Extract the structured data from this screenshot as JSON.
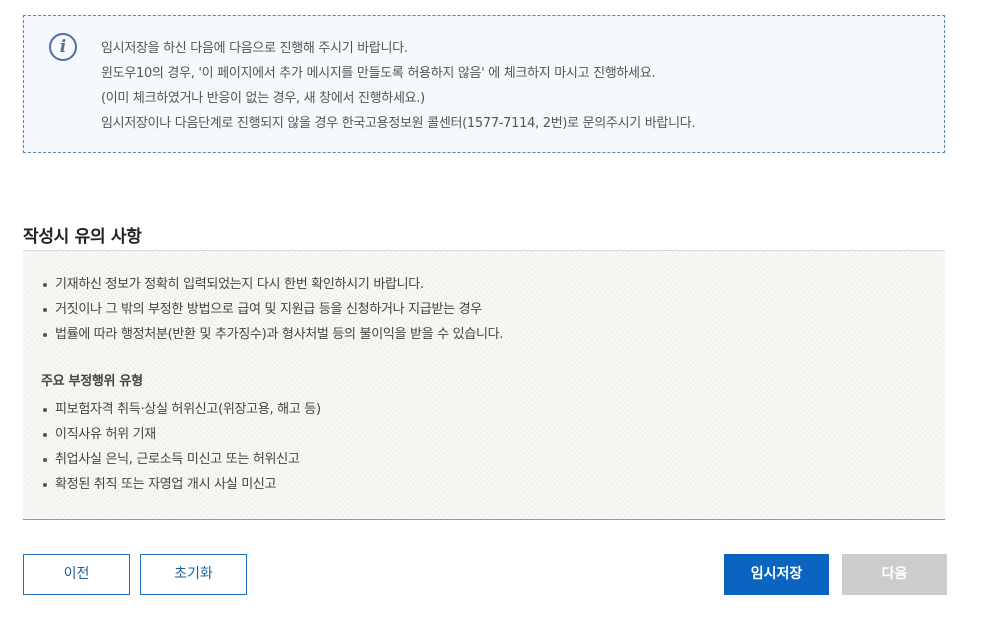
{
  "notice": {
    "icon": "info-icon",
    "lines": [
      "임시저장을 하신 다음에 다음으로 진행해 주시기 바랍니다.",
      "윈도우10의 경우, '이 페이지에서 추가 메시지를 만들도록 허용하지 않음' 에 체크하지 마시고 진행하세요.",
      "(이미 체크하였거나 반응이 없는 경우, 새 창에서 진행하세요.)",
      "임시저장이나 다음단계로 진행되지 않을 경우 한국고용정보원 콜센터(1577-7114, 2번)로 문의주시기 바랍니다."
    ]
  },
  "caution": {
    "title": "작성시 유의 사항",
    "items": [
      "기재하신 정보가 정확히 입력되었는지 다시 한번 확인하시기 바랍니다.",
      "거짓이나 그 밖의 부정한 방법으로 급여 및 지원급 등을 신청하거나 지급받는 경우",
      "법률에 따라 행정처분(반환 및 추가징수)과 형사처벌 등의 불이익을 받을 수 있습니다."
    ],
    "subheading": "주요 부정행위 유형",
    "fraud_types": [
      "피보험자격 취득·상실 허위신고(위장고용, 해고 등)",
      "이직사유 허위 기재",
      "취업사실 은닉, 근로소득 미신고 또는 허위신고",
      "확정된 취직 또는 자영업 개시 사실 미신고"
    ]
  },
  "buttons": {
    "prev": "이전",
    "reset": "초기화",
    "save": "임시저장",
    "next": "다음"
  },
  "colors": {
    "primary": "#0a64c0",
    "disabled": "#cccccc",
    "notice_border": "#5a86a8",
    "notice_bg": "#f5f9fd"
  }
}
